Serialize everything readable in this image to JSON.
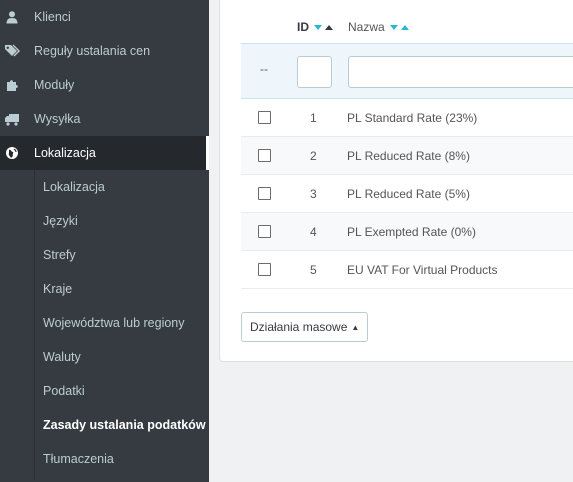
{
  "sidebar": {
    "items": [
      {
        "label": "Klienci",
        "icon": "user-icon"
      },
      {
        "label": "Reguły ustalania cen",
        "icon": "tags-icon"
      },
      {
        "label": "Moduły",
        "icon": "puzzle-icon"
      },
      {
        "label": "Wysyłka",
        "icon": "truck-icon"
      },
      {
        "label": "Lokalizacja",
        "icon": "globe-icon",
        "active": true
      }
    ],
    "submenu": [
      {
        "label": "Lokalizacja"
      },
      {
        "label": "Języki"
      },
      {
        "label": "Strefy"
      },
      {
        "label": "Kraje"
      },
      {
        "label": "Województwa lub regiony"
      },
      {
        "label": "Waluty"
      },
      {
        "label": "Podatki"
      },
      {
        "label": "Zasady ustalania podatków",
        "current": true
      },
      {
        "label": "Tłumaczenia"
      }
    ]
  },
  "table": {
    "columns": {
      "id": "ID",
      "name": "Nazwa"
    },
    "filter": {
      "dash": "--",
      "id_value": "",
      "name_value": ""
    },
    "rows": [
      {
        "id": "1",
        "name": "PL Standard Rate (23%)"
      },
      {
        "id": "2",
        "name": "PL Reduced Rate (8%)"
      },
      {
        "id": "3",
        "name": "PL Reduced Rate (5%)"
      },
      {
        "id": "4",
        "name": "PL Exempted Rate (0%)"
      },
      {
        "id": "5",
        "name": "EU VAT For Virtual Products"
      }
    ]
  },
  "bulk_actions": {
    "label": "Działania masowe"
  },
  "colors": {
    "sidebar_bg": "#363a41",
    "active_bg": "#25282d",
    "accent": "#25b9d7",
    "filter_bg": "#eef6fb"
  }
}
